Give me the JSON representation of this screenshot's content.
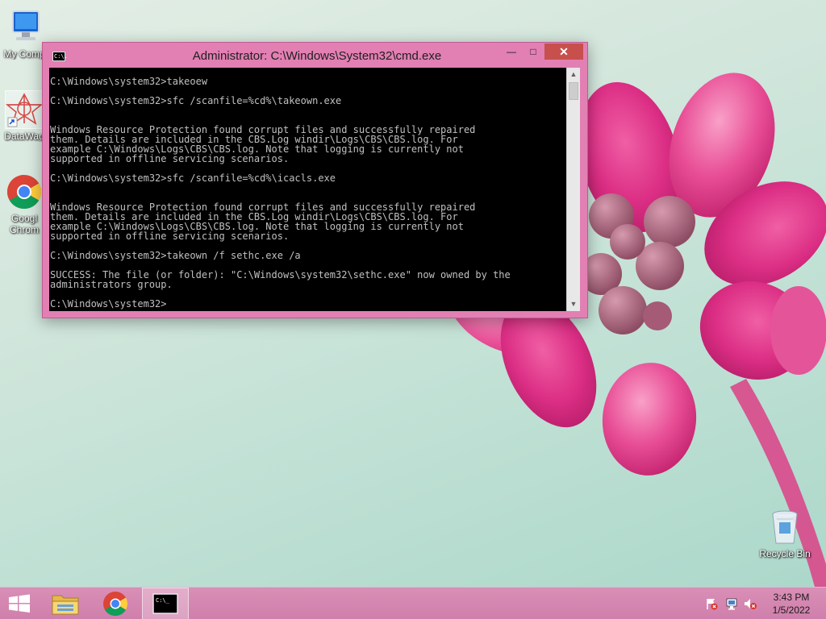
{
  "desktop": {
    "icons": [
      {
        "label": "My Comp"
      },
      {
        "label": "DataWag"
      },
      {
        "label": "Googl\nChrom"
      },
      {
        "label": "Recycle Bin"
      }
    ]
  },
  "cmd_window": {
    "title": "Administrator: C:\\Windows\\System32\\cmd.exe",
    "icon_text": "C:\\.",
    "buttons": {
      "minimize": "—",
      "maximize": "□",
      "close": "✕"
    },
    "output": "C:\\Windows\\system32>takeoew\n\nC:\\Windows\\system32>sfc /scanfile=%cd%\\takeown.exe\n\n\nWindows Resource Protection found corrupt files and successfully repaired\nthem. Details are included in the CBS.Log windir\\Logs\\CBS\\CBS.log. For\nexample C:\\Windows\\Logs\\CBS\\CBS.log. Note that logging is currently not\nsupported in offline servicing scenarios.\n\nC:\\Windows\\system32>sfc /scanfile=%cd%\\icacls.exe\n\n\nWindows Resource Protection found corrupt files and successfully repaired\nthem. Details are included in the CBS.Log windir\\Logs\\CBS\\CBS.log. For\nexample C:\\Windows\\Logs\\CBS\\CBS.log. Note that logging is currently not\nsupported in offline servicing scenarios.\n\nC:\\Windows\\system32>takeown /f sethc.exe /a\n\nSUCCESS: The file (or folder): \"C:\\Windows\\system32\\sethc.exe\" now owned by the\nadministrators group.\n\nC:\\Windows\\system32>"
  },
  "taskbar": {
    "items": [
      "start",
      "file-explorer",
      "google-chrome",
      "command-prompt"
    ],
    "active_item": "command-prompt",
    "cmd_icon_text": "C:\\_",
    "tray_icons": [
      "action-center-flag-icon",
      "network-icon",
      "volume-muted-icon"
    ],
    "clock": {
      "time": "3:43 PM",
      "date": "1/5/2022"
    }
  },
  "colors": {
    "accent": "#e27fb3",
    "taskbar": "#d38aaf",
    "close_button": "#c7504d",
    "console_bg": "#000000",
    "console_fg": "#c0c0c0"
  }
}
